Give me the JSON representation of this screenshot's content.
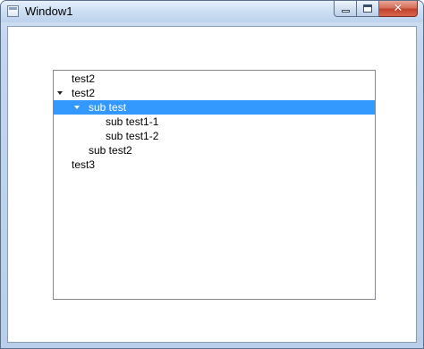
{
  "window": {
    "title": "Window1",
    "close_glyph": "✕"
  },
  "tree": {
    "items": [
      {
        "label": "test2",
        "level": 0,
        "expanded": false,
        "has_children": false,
        "selected": false
      },
      {
        "label": "test2",
        "level": 0,
        "expanded": true,
        "has_children": true,
        "selected": false
      },
      {
        "label": "sub test",
        "level": 1,
        "expanded": true,
        "has_children": true,
        "selected": true
      },
      {
        "label": "sub test1-1",
        "level": 2,
        "expanded": false,
        "has_children": false,
        "selected": false
      },
      {
        "label": "sub test1-2",
        "level": 2,
        "expanded": false,
        "has_children": false,
        "selected": false
      },
      {
        "label": "sub test2",
        "level": 1,
        "expanded": false,
        "has_children": false,
        "selected": false
      },
      {
        "label": "test3",
        "level": 0,
        "expanded": false,
        "has_children": false,
        "selected": false
      }
    ]
  },
  "colors": {
    "selection": "#3399ff",
    "close_button": "#c0432c"
  }
}
